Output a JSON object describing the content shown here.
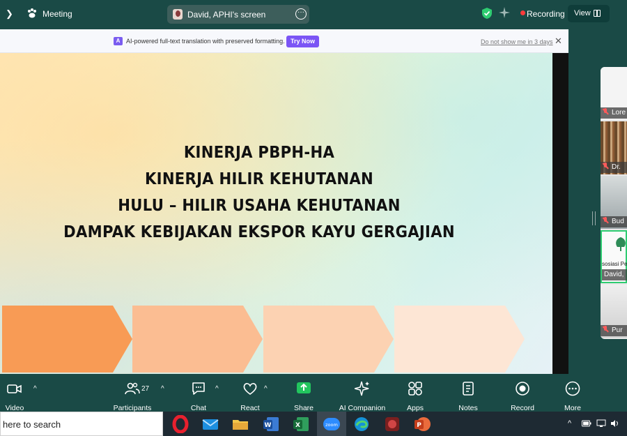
{
  "topbar": {
    "meeting_label": "Meeting",
    "share_label": "David, APHI's screen",
    "recording_label": "Recording",
    "view_label": "View"
  },
  "banner": {
    "icon_text": "A",
    "message": "AI-powered full-text translation with preserved formatting.",
    "try_label": "Try Now",
    "dont_show_label": "Do not show me in 3 days",
    "close_glyph": "✕"
  },
  "slide": {
    "lines": [
      "KINERJA PBPH-HA",
      "KINERJA HILIR KEHUTANAN",
      "HULU – HILIR USAHA KEHUTANAN",
      "DAMPAK KEBIJAKAN EKSPOR KAYU GERGAJIAN"
    ],
    "chevron_colors": [
      "#f89b55",
      "#fbbd92",
      "#fcd2b2",
      "#fde6d5"
    ]
  },
  "participants_panel": [
    {
      "name": "Lore",
      "muted": true
    },
    {
      "name": "Dr.",
      "muted": true
    },
    {
      "name": "Bud",
      "muted": true
    },
    {
      "name": "David,",
      "muted": false,
      "caption": "sosiasi Pe"
    },
    {
      "name": "Pur",
      "muted": true
    }
  ],
  "toolbar": {
    "video": "Video",
    "participants": "Participants",
    "participants_count": "27",
    "chat": "Chat",
    "react": "React",
    "share": "Share",
    "ai_companion": "AI Companion",
    "apps": "Apps",
    "notes": "Notes",
    "record": "Record",
    "more": "More",
    "accent_share": "#22c55e"
  },
  "taskbar": {
    "search_text": "here to search",
    "zoom_label": "zoom",
    "apps": [
      "opera",
      "mail",
      "file-explorer",
      "word",
      "excel",
      "zoom",
      "edge",
      "app-64",
      "powerpoint"
    ]
  }
}
